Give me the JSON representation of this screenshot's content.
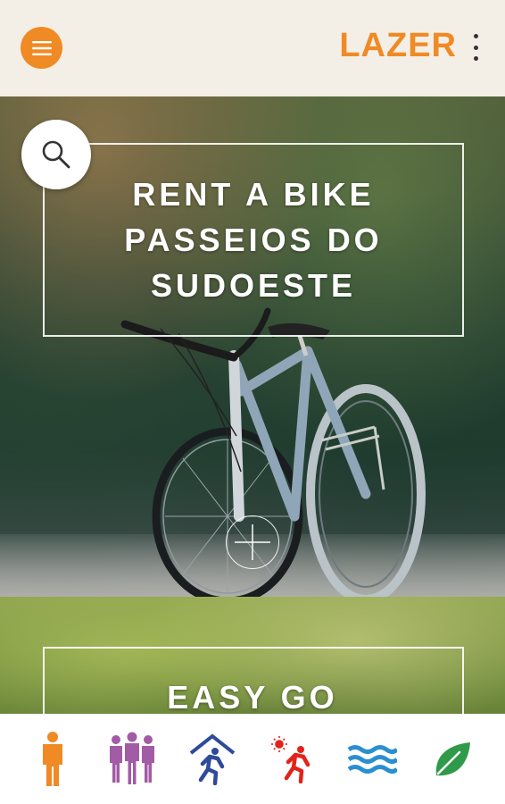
{
  "header": {
    "title": "LAZER",
    "menu_icon": "hamburger-menu-icon",
    "more_icon": "more-vertical-icon",
    "accent_color": "#f08a24"
  },
  "cards": [
    {
      "lines": [
        "RENT A BIKE",
        "PASSEIOS DO",
        "SUDOESTE"
      ],
      "search_icon": "search-icon",
      "expand_icon": "plus-icon"
    },
    {
      "title": "EASY GO"
    }
  ],
  "bottom_nav": {
    "items": [
      {
        "icon": "person-icon",
        "color": "#f08a24"
      },
      {
        "icon": "group-icon",
        "color": "#a25ba5"
      },
      {
        "icon": "indoor-activity-icon",
        "color": "#2e4a9a"
      },
      {
        "icon": "outdoor-activity-icon",
        "color": "#e2231a"
      },
      {
        "icon": "water-icon",
        "color": "#2a8fd0"
      },
      {
        "icon": "leaf-icon",
        "color": "#2f9a4a"
      }
    ]
  }
}
